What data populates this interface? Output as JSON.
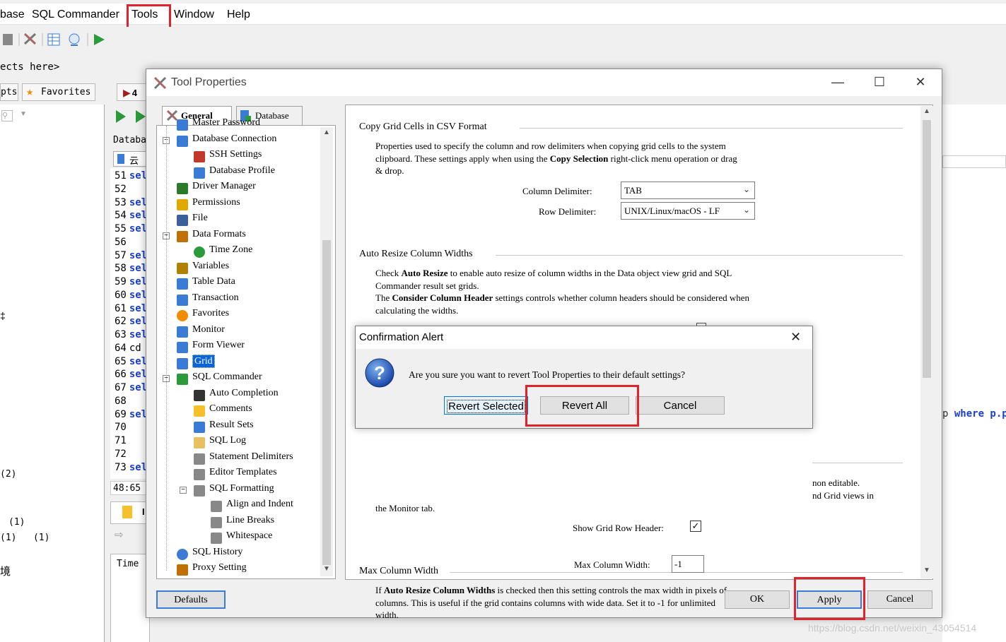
{
  "app": {
    "menu": [
      "base",
      "SQL Commander",
      "Tools",
      "Window",
      "Help"
    ],
    "objects_here": "ects here>",
    "left_tabs": [
      "pts",
      "Favorites"
    ],
    "database_label": "Databa",
    "editor_lines": [
      {
        "n": "51",
        "t": "sel"
      },
      {
        "n": "52",
        "t": ""
      },
      {
        "n": "53",
        "t": "sel"
      },
      {
        "n": "54",
        "t": "sel"
      },
      {
        "n": "55",
        "t": "sel"
      },
      {
        "n": "56",
        "t": ""
      },
      {
        "n": "57",
        "t": "sel"
      },
      {
        "n": "58",
        "t": "sel"
      },
      {
        "n": "59",
        "t": "sel"
      },
      {
        "n": "60",
        "t": "sel"
      },
      {
        "n": "61",
        "t": "sel"
      },
      {
        "n": "62",
        "t": "sel"
      },
      {
        "n": "63",
        "t": "sel"
      },
      {
        "n": "64",
        "t": "cd"
      },
      {
        "n": "65",
        "t": "sel"
      },
      {
        "n": "66",
        "t": "sel"
      },
      {
        "n": "67",
        "t": "sel"
      },
      {
        "n": "68",
        "t": ""
      },
      {
        "n": "69",
        "t": "sel"
      },
      {
        "n": "70",
        "t": ""
      },
      {
        "n": "71",
        "t": ""
      },
      {
        "n": "72",
        "t": ""
      },
      {
        "n": "73",
        "t": "sel"
      }
    ],
    "cursor_pos": "48:65",
    "time_label": "Time",
    "left_texts": [
      "(2)",
      "(1)",
      "(1)   (1)",
      "境"
    ],
    "right_text": "where p.p",
    "watermark": "https://blog.csdn.net/weixin_43054514"
  },
  "dialog": {
    "title": "Tool Properties",
    "tabs": [
      "General",
      "Database"
    ],
    "tree": [
      {
        "label": "Master Password",
        "level": 1
      },
      {
        "label": "Database Connection",
        "level": 1
      },
      {
        "label": "SSH Settings",
        "level": 2
      },
      {
        "label": "Database Profile",
        "level": 2
      },
      {
        "label": "Driver Manager",
        "level": 1
      },
      {
        "label": "Permissions",
        "level": 1
      },
      {
        "label": "File",
        "level": 1
      },
      {
        "label": "Data Formats",
        "level": 1
      },
      {
        "label": "Time Zone",
        "level": 2
      },
      {
        "label": "Variables",
        "level": 1
      },
      {
        "label": "Table Data",
        "level": 1
      },
      {
        "label": "Transaction",
        "level": 1
      },
      {
        "label": "Favorites",
        "level": 1
      },
      {
        "label": "Monitor",
        "level": 1
      },
      {
        "label": "Form Viewer",
        "level": 1
      },
      {
        "label": "Grid",
        "level": 1
      },
      {
        "label": "SQL Commander",
        "level": 1
      },
      {
        "label": "Auto Completion",
        "level": 2
      },
      {
        "label": "Comments",
        "level": 2
      },
      {
        "label": "Result Sets",
        "level": 2
      },
      {
        "label": "SQL Log",
        "level": 2
      },
      {
        "label": "Statement Delimiters",
        "level": 2
      },
      {
        "label": "Editor Templates",
        "level": 2
      },
      {
        "label": "SQL Formatting",
        "level": 2
      },
      {
        "label": "Align and Indent",
        "level": 3
      },
      {
        "label": "Line Breaks",
        "level": 3
      },
      {
        "label": "Whitespace",
        "level": 3
      },
      {
        "label": "SQL History",
        "level": 1
      },
      {
        "label": "Proxy Setting",
        "level": 1
      }
    ],
    "csv": {
      "title": "Copy Grid Cells in CSV Format",
      "l1a": "Properties used to specify the column and row delimiters when copying grid cells to the system",
      "l2a": "clipboard.  These settings apply when using the ",
      "l2b": "Copy Selection",
      "l2c": " right-click menu operation or drag",
      "l3": "& drop.",
      "col_label": "Column Delimiter:",
      "col_value": "TAB",
      "row_label": "Row Delimiter:",
      "row_value": "UNIX/Linux/macOS - LF"
    },
    "autoresize": {
      "title": "Auto Resize Column Widths",
      "l1a": "Check ",
      "l1b": "Auto Resize",
      "l1c": " to enable auto resize of column widths in the Data object view grid and SQL",
      "l2": "Commander result set grids.",
      "l3a": "The ",
      "l3b": "Consider Column Header",
      "l3c": " settings controls whether column headers should be considered when",
      "l4": "calculating the widths."
    },
    "header": {
      "r1": "non editable.",
      "r2": "nd Grid views in",
      "l3": "the Monitor tab.",
      "show_label": "Show Grid Row Header:"
    },
    "maxcol": {
      "title": "Max Column Width",
      "l1a": "If ",
      "l1b": "Auto Resize Column Widths",
      "l1c": " is checked then this setting controls the max width in pixels of",
      "l2": "columns. This is useful if the grid contains columns with wide data. Set it to -1 for unlimited",
      "l3": "width.",
      "label": "Max Column Width:",
      "value": "-1"
    },
    "buttons": {
      "defaults": "Defaults",
      "ok": "OK",
      "apply": "Apply",
      "cancel": "Cancel"
    }
  },
  "alert": {
    "title": "Confirmation Alert",
    "message": "Are you sure you want to revert Tool Properties to their default settings?",
    "revert_selected": "Revert Selected",
    "revert_all": "Revert All",
    "cancel": "Cancel"
  },
  "colors": {
    "highlight_red": "#e0232b",
    "selection_blue": "#0a64d8",
    "keyword_blue": "#1a3fcf"
  }
}
